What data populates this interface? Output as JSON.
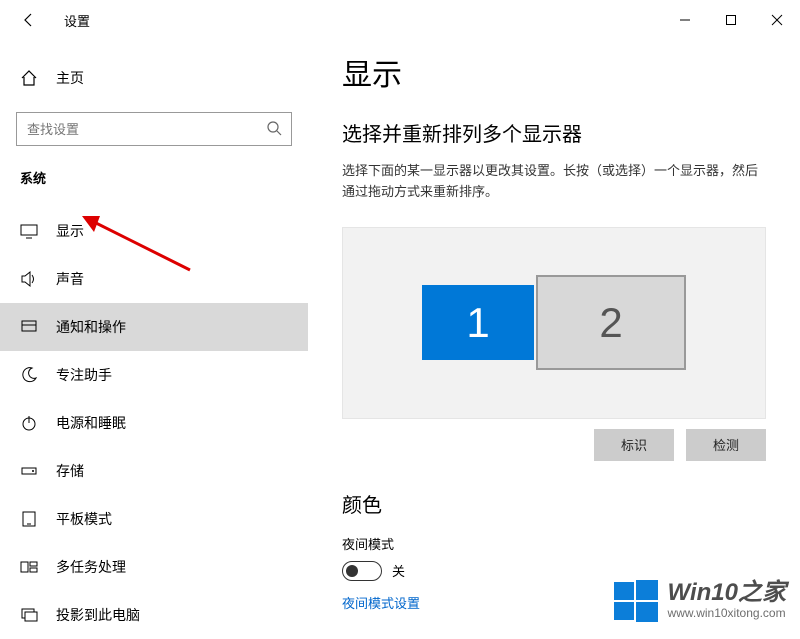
{
  "titlebar": {
    "app_title": "设置"
  },
  "sidebar": {
    "home_label": "主页",
    "search_placeholder": "查找设置",
    "section_label": "系统",
    "items": [
      {
        "label": "显示"
      },
      {
        "label": "声音"
      },
      {
        "label": "通知和操作"
      },
      {
        "label": "专注助手"
      },
      {
        "label": "电源和睡眠"
      },
      {
        "label": "存储"
      },
      {
        "label": "平板模式"
      },
      {
        "label": "多任务处理"
      },
      {
        "label": "投影到此电脑"
      }
    ]
  },
  "main": {
    "page_title": "显示",
    "arrange": {
      "heading": "选择并重新排列多个显示器",
      "desc": "选择下面的某一显示器以更改其设置。长按（或选择）一个显示器，然后通过拖动方式来重新排序。",
      "monitor1": "1",
      "monitor2": "2",
      "identify_btn": "标识",
      "detect_btn": "检测"
    },
    "color": {
      "heading": "颜色",
      "night_label": "夜间模式",
      "toggle_state": "关",
      "settings_link": "夜间模式设置"
    }
  },
  "watermark": {
    "title": "Win10之家",
    "url": "www.win10xitong.com"
  }
}
